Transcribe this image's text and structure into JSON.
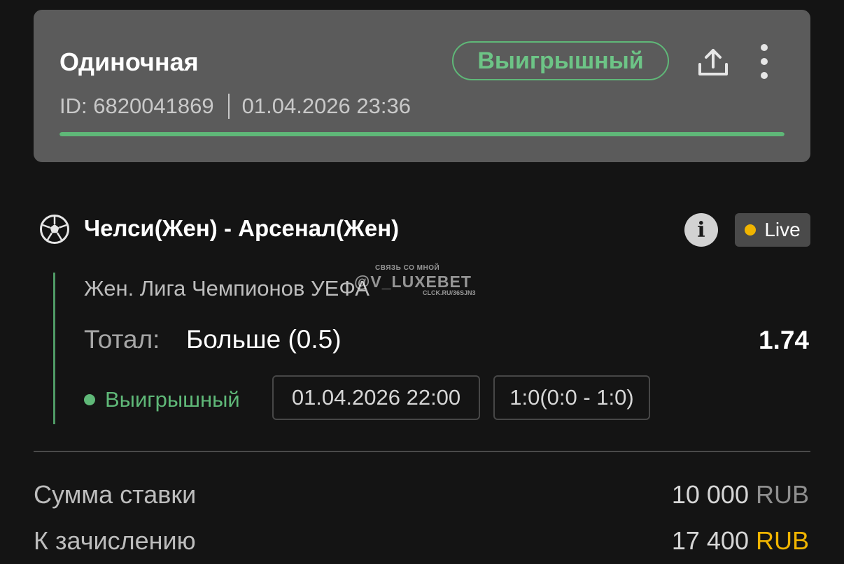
{
  "header": {
    "bet_type": "Одиночная",
    "status_pill": "Выигрышный",
    "id_text": "ID: 6820041869",
    "datetime": "01.04.2026 23:36",
    "progress": 1.0,
    "colors": {
      "accent_green": "#5fb878",
      "card_bg": "#5b5b5b"
    },
    "icons": {
      "share": "share-upload-icon",
      "more": "more-vertical-icon"
    }
  },
  "event": {
    "sport_icon": "soccer-ball-icon",
    "title": "Челси(Жен) - Арсенал(Жен)",
    "info_icon": "info-icon",
    "live_label": "Live",
    "live_dot_color": "#f0b400",
    "league": "Жен. Лига Чемпионов УЕФА",
    "market_label": "Тотал:",
    "selection": "Больше (0.5)",
    "odds": "1.74",
    "result_status": "Выигрышный",
    "event_datetime": "01.04.2026 22:00",
    "score": "1:0(0:0 - 1:0)"
  },
  "watermark": {
    "top_text": "СВЯЗЬ СО МНОЙ",
    "brand": "@V_LUXEBET",
    "link": "CLCK.RU/36SJN3"
  },
  "summary": {
    "stake_label": "Сумма ставки",
    "stake_amount": "10 000",
    "stake_currency": "RUB",
    "payout_label": "К зачислению",
    "payout_amount": "17 400",
    "payout_currency": "RUB",
    "colors": {
      "currency_gold": "#f0b400",
      "currency_gray": "#8f8f8f"
    }
  }
}
